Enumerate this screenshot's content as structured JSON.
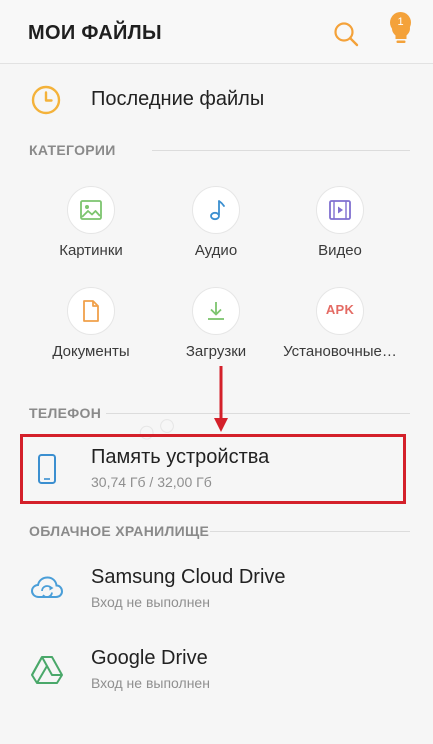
{
  "app": {
    "title": "МОИ ФАЙЛЫ",
    "notification_count": "1"
  },
  "recent": {
    "label": "Последние файлы"
  },
  "categories": {
    "header": "КАТЕГОРИИ",
    "items": [
      {
        "label": "Картинки",
        "icon": "image-icon",
        "color": "#7cc46e"
      },
      {
        "label": "Аудио",
        "icon": "music-note-icon",
        "color": "#3b8fd0"
      },
      {
        "label": "Видео",
        "icon": "video-icon",
        "color": "#7f6fd0"
      },
      {
        "label": "Документы",
        "icon": "document-icon",
        "color": "#f0a04a"
      },
      {
        "label": "Загрузки",
        "icon": "download-icon",
        "color": "#7cc46e"
      },
      {
        "label": "Установочные…",
        "icon": "apk-icon",
        "icon_text": "APK",
        "color": "#e46b64"
      }
    ]
  },
  "phone": {
    "header": "ТЕЛЕФОН",
    "device_storage": {
      "title": "Память устройства",
      "usage": "30,74 Гб / 32,00 Гб"
    }
  },
  "cloud": {
    "header": "ОБЛАЧНОЕ ХРАНИЛИЩЕ",
    "items": [
      {
        "title": "Samsung Cloud Drive",
        "status": "Вход не выполнен"
      },
      {
        "title": "Google Drive",
        "status": "Вход не выполнен"
      }
    ]
  },
  "colors": {
    "accent_orange": "#f4a23a",
    "highlight_red": "#d4202a"
  }
}
